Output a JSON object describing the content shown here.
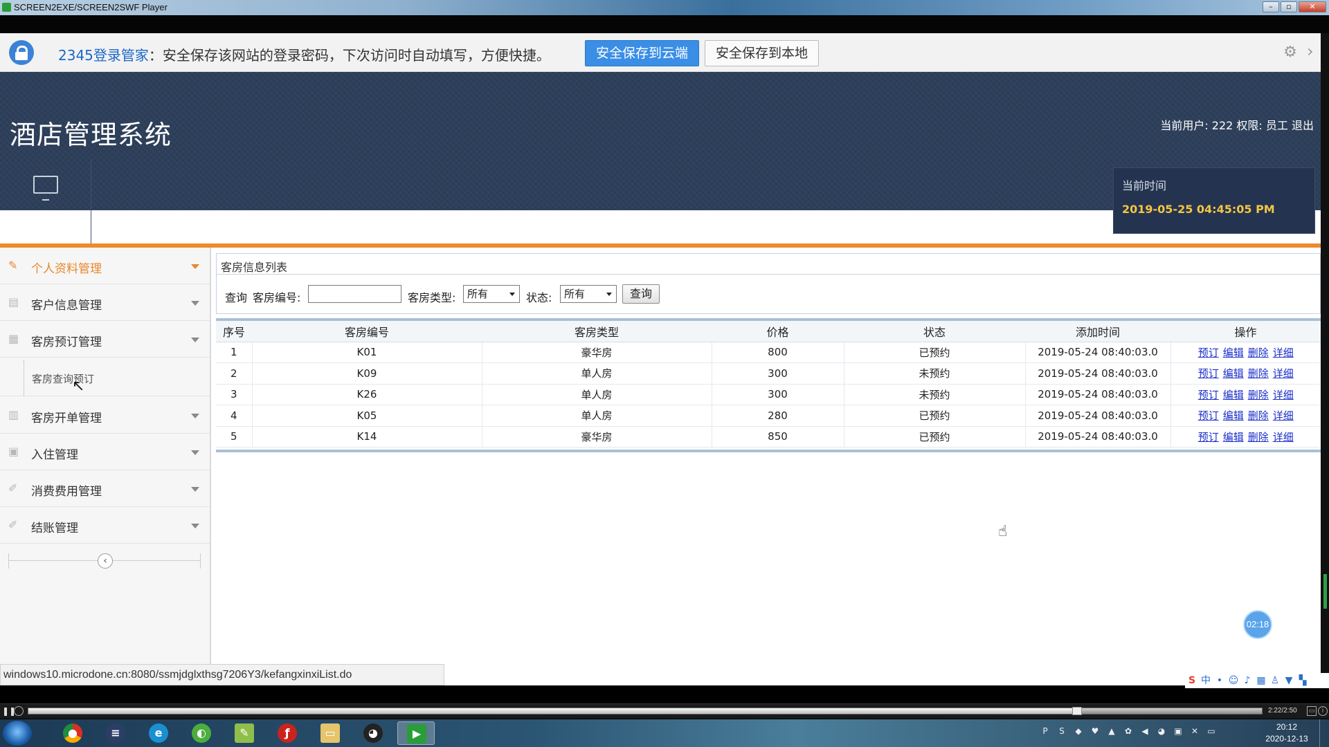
{
  "window": {
    "title": "SCREEN2EXE/SCREEN2SWF Player"
  },
  "password_bar": {
    "brand": "2345登录管家",
    "message": "：安全保存该网站的登录密码，下次访问时自动填写，方便快捷。",
    "save_cloud": "安全保存到云端",
    "save_local": "安全保存到本地"
  },
  "header": {
    "title": "酒店管理系统",
    "user_info": "当前用户: 222 权限: 员工 退出",
    "desktop_label": "显示桌面",
    "time_label": "当前时间",
    "time_value": "2019-05-25 04:45:05 PM"
  },
  "sidebar": {
    "items": [
      {
        "label": "个人资料管理",
        "active": true
      },
      {
        "label": "客户信息管理"
      },
      {
        "label": "客房预订管理"
      },
      {
        "label": "客房开单管理"
      },
      {
        "label": "入住管理"
      },
      {
        "label": "消费费用管理"
      },
      {
        "label": "结账管理"
      }
    ],
    "sub_item": "客房查询预订",
    "collapse_glyph": "‹"
  },
  "panel": {
    "title": "客房信息列表",
    "search": {
      "query_label": "查询",
      "room_no_label": "客房编号:",
      "room_no_value": "",
      "room_type_label": "客房类型:",
      "room_type_value": "所有",
      "status_label": "状态:",
      "status_value": "所有",
      "button": "查询"
    },
    "table": {
      "columns": [
        "序号",
        "客房编号",
        "客房类型",
        "价格",
        "状态",
        "添加时间",
        "操作"
      ],
      "rows": [
        {
          "no": "1",
          "room": "K01",
          "type": "豪华房",
          "price": "800",
          "status": "已预约",
          "time": "2019-05-24 08:40:03.0"
        },
        {
          "no": "2",
          "room": "K09",
          "type": "单人房",
          "price": "300",
          "status": "未预约",
          "time": "2019-05-24 08:40:03.0"
        },
        {
          "no": "3",
          "room": "K26",
          "type": "单人房",
          "price": "300",
          "status": "未预约",
          "time": "2019-05-24 08:40:03.0"
        },
        {
          "no": "4",
          "room": "K05",
          "type": "单人房",
          "price": "280",
          "status": "已预约",
          "time": "2019-05-24 08:40:03.0"
        },
        {
          "no": "5",
          "room": "K14",
          "type": "豪华房",
          "price": "850",
          "status": "已预约",
          "time": "2019-05-24 08:40:03.0"
        }
      ],
      "actions": [
        "预订",
        "编辑",
        "删除",
        "详细"
      ]
    }
  },
  "status_url": "windows10.microdone.cn:8080/ssmjdglxthsg7206Y3/kefangxinxiList.do",
  "timer_badge": "02:18",
  "player": {
    "time": "2:22/2:50",
    "progress": 0.85
  },
  "taskbar": {
    "clock_time": "20:12",
    "clock_date": "2020-12-13"
  },
  "colors": {
    "accent_orange": "#ee8a2a",
    "header_bg": "#2d3f5a",
    "link_blue": "#1a2fc9"
  }
}
